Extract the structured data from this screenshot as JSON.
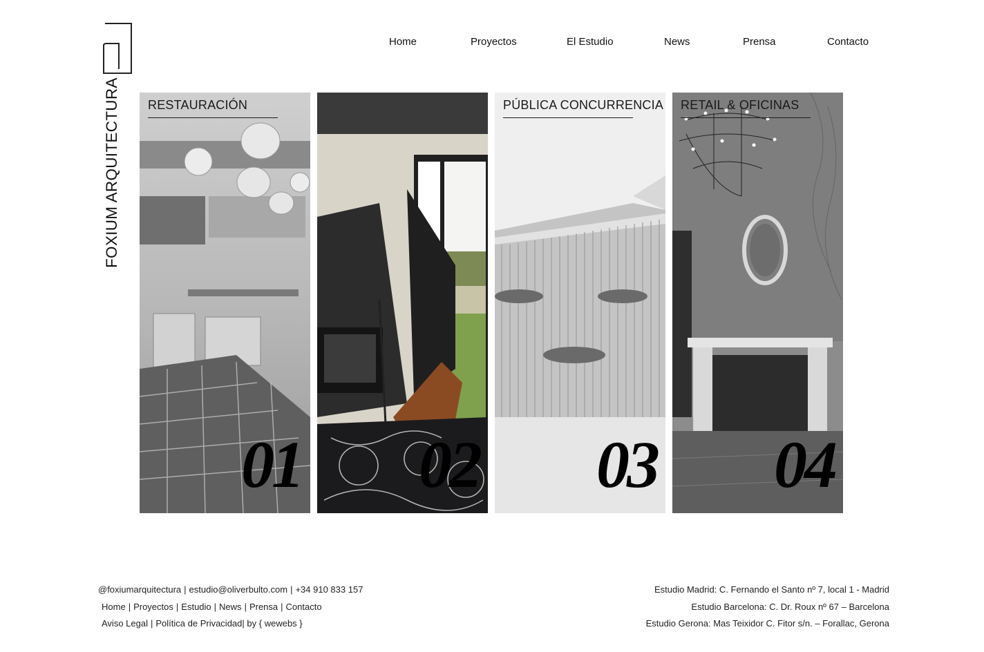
{
  "brand": {
    "name": "FOXIUM ARQUITECTURA"
  },
  "nav": {
    "items": [
      {
        "label": "Home"
      },
      {
        "label": "Proyectos"
      },
      {
        "label": "El Estudio"
      },
      {
        "label": "News"
      },
      {
        "label": "Prensa"
      },
      {
        "label": "Contacto"
      }
    ]
  },
  "categories": [
    {
      "label": "RESTAURACIÓN",
      "number": "01"
    },
    {
      "label": "",
      "number": "02"
    },
    {
      "label": "PÚBLICA CONCURRENCIA",
      "number": "03"
    },
    {
      "label": "RETAIL & OFICINAS",
      "number": "04"
    }
  ],
  "footer": {
    "instagram": "@foxiumarquitectura",
    "email": "estudio@oliverbulto.com",
    "phone": "+34 910 833 157",
    "links": [
      "Home",
      "Proyectos",
      "Estudio",
      "News",
      "Prensa",
      "Contacto"
    ],
    "legal": [
      "Aviso Legal",
      "Política de Privacidad",
      "by { wewebs }"
    ],
    "addresses": [
      "Estudio Madrid: C. Fernando el Santo nº 7, local 1 - Madrid",
      "Estudio Barcelona: C. Dr. Roux nº 67 – Barcelona",
      "Estudio Gerona: Mas Teixidor C. Fitor s/n. – Forallac, Gerona"
    ]
  },
  "colors": {
    "text": "#111111",
    "background": "#ffffff"
  }
}
